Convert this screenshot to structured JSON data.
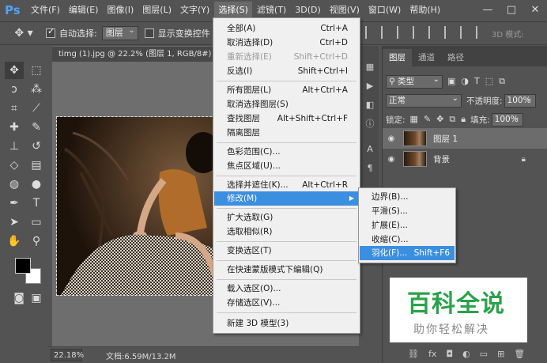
{
  "menubar": {
    "logo": "Ps",
    "items": [
      "文件(F)",
      "编辑(E)",
      "图像(I)",
      "图层(L)",
      "文字(Y)",
      "选择(S)",
      "滤镜(T)",
      "3D(D)",
      "视图(V)",
      "窗口(W)",
      "帮助(H)"
    ],
    "active_index": 5,
    "window_controls": [
      "—",
      "□",
      "✕"
    ]
  },
  "optbar": {
    "auto_select_label": "自动选择:",
    "auto_select_checked": true,
    "auto_select_value": "图层",
    "show_transform_label": "显示变换控件",
    "show_transform_checked": false,
    "mode_3d_label": "3D 模式:"
  },
  "document": {
    "tab_title": "timg (1).jpg @ 22.2% (图层 1, RGB/8#) *",
    "tab_close": "×",
    "zoom": "22.18%",
    "doc_info": "文档:6.59M/13.2M"
  },
  "select_menu": {
    "items": [
      {
        "label": "全部(A)",
        "shortcut": "Ctrl+A"
      },
      {
        "label": "取消选择(D)",
        "shortcut": "Ctrl+D"
      },
      {
        "label": "重新选择(E)",
        "shortcut": "Shift+Ctrl+D",
        "disabled": true
      },
      {
        "label": "反选(I)",
        "shortcut": "Shift+Ctrl+I"
      },
      {
        "label": "所有图层(L)",
        "shortcut": "Alt+Ctrl+A"
      },
      {
        "label": "取消选择图层(S)",
        "shortcut": ""
      },
      {
        "label": "查找图层",
        "shortcut": "Alt+Shift+Ctrl+F"
      },
      {
        "label": "隔离图层",
        "shortcut": ""
      },
      {
        "label": "色彩范围(C)...",
        "shortcut": ""
      },
      {
        "label": "焦点区域(U)...",
        "shortcut": ""
      },
      {
        "label": "选择并遮住(K)...",
        "shortcut": "Alt+Ctrl+R"
      },
      {
        "label": "修改(M)",
        "shortcut": "",
        "submenu": true,
        "highlighted": true
      },
      {
        "label": "扩大选取(G)",
        "shortcut": ""
      },
      {
        "label": "选取相似(R)",
        "shortcut": ""
      },
      {
        "label": "变换选区(T)",
        "shortcut": ""
      },
      {
        "label": "在快速蒙版模式下编辑(Q)",
        "shortcut": ""
      },
      {
        "label": "载入选区(O)...",
        "shortcut": ""
      },
      {
        "label": "存储选区(V)...",
        "shortcut": ""
      },
      {
        "label": "新建 3D 模型(3)",
        "shortcut": ""
      }
    ]
  },
  "modify_submenu": {
    "items": [
      {
        "label": "边界(B)...",
        "shortcut": ""
      },
      {
        "label": "平滑(S)...",
        "shortcut": ""
      },
      {
        "label": "扩展(E)...",
        "shortcut": ""
      },
      {
        "label": "收缩(C)...",
        "shortcut": ""
      },
      {
        "label": "羽化(F)...",
        "shortcut": "Shift+F6",
        "highlighted": true
      }
    ]
  },
  "layers_panel": {
    "tabs": [
      "图层",
      "通道",
      "路径"
    ],
    "active_tab": 0,
    "filter_kind": "类型",
    "blend_mode": "正常",
    "opacity_label": "不透明度:",
    "opacity_value": "100%",
    "lock_label": "锁定:",
    "fill_label": "填充:",
    "fill_value": "100%",
    "layers": [
      {
        "name": "图层 1",
        "selected": true,
        "locked": false
      },
      {
        "name": "背景",
        "selected": false,
        "locked": true
      }
    ]
  },
  "watermark": {
    "title": "百科全说",
    "subtitle": "助你轻松解决"
  },
  "colors": {
    "accent": "#3b8fe0",
    "watermark_green": "#2aa24a"
  }
}
